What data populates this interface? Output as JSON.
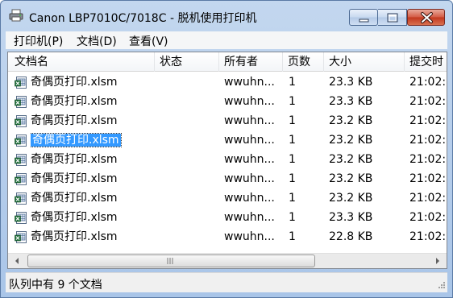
{
  "window": {
    "title": "Canon LBP7010C/7018C  -  脱机使用打印机"
  },
  "menu": {
    "items": [
      {
        "label": "打印机(P)"
      },
      {
        "label": "文档(D)"
      },
      {
        "label": "查看(V)"
      }
    ]
  },
  "columns": [
    {
      "label": "文档名"
    },
    {
      "label": "状态"
    },
    {
      "label": "所有者"
    },
    {
      "label": "页数"
    },
    {
      "label": "大小"
    },
    {
      "label": "提交时"
    }
  ],
  "rows": [
    {
      "name": "奇偶页打印.xlsm",
      "status": "",
      "owner": "wwuhn...",
      "pages": "1",
      "size": "23.3 KB",
      "submitted": "21:02:",
      "selected": false
    },
    {
      "name": "奇偶页打印.xlsm",
      "status": "",
      "owner": "wwuhn...",
      "pages": "1",
      "size": "23.3 KB",
      "submitted": "21:02:",
      "selected": false
    },
    {
      "name": "奇偶页打印.xlsm",
      "status": "",
      "owner": "wwuhn...",
      "pages": "1",
      "size": "23.2 KB",
      "submitted": "21:02:",
      "selected": false
    },
    {
      "name": "奇偶页打印.xlsm",
      "status": "",
      "owner": "wwuhn...",
      "pages": "1",
      "size": "23.2 KB",
      "submitted": "21:02:",
      "selected": true
    },
    {
      "name": "奇偶页打印.xlsm",
      "status": "",
      "owner": "wwuhn...",
      "pages": "1",
      "size": "23.2 KB",
      "submitted": "21:02:",
      "selected": false
    },
    {
      "name": "奇偶页打印.xlsm",
      "status": "",
      "owner": "wwuhn...",
      "pages": "1",
      "size": "23.2 KB",
      "submitted": "21:02:",
      "selected": false
    },
    {
      "name": "奇偶页打印.xlsm",
      "status": "",
      "owner": "wwuhn...",
      "pages": "1",
      "size": "23.2 KB",
      "submitted": "21:02:",
      "selected": false
    },
    {
      "name": "奇偶页打印.xlsm",
      "status": "",
      "owner": "wwuhn...",
      "pages": "1",
      "size": "23.3 KB",
      "submitted": "21:02:",
      "selected": false
    },
    {
      "name": "奇偶页打印.xlsm",
      "status": "",
      "owner": "wwuhn...",
      "pages": "1",
      "size": "22.8 KB",
      "submitted": "21:02:",
      "selected": false
    }
  ],
  "statusbar": {
    "text": "队列中有 9 个文档"
  },
  "icons": {
    "app": "printer-icon",
    "file": "excel-document-icon",
    "minimize": "minimize-icon",
    "maximize": "maximize-icon",
    "close": "close-icon"
  },
  "colors": {
    "selection": "#3399ff",
    "titlebar": "#b9d1ea",
    "close_button": "#c7452d"
  }
}
